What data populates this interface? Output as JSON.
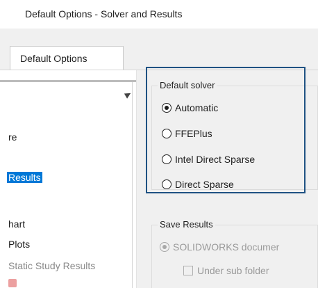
{
  "window": {
    "title": "Default Options - Solver and Results"
  },
  "tabs": [
    {
      "label": "Default Options",
      "active": true
    }
  ],
  "tree": {
    "items": [
      {
        "label": "re",
        "selected": false,
        "dimmed": false
      },
      {
        "label": "Results",
        "selected": true,
        "dimmed": false
      },
      {
        "label": "hart",
        "selected": false,
        "dimmed": false
      },
      {
        "label": "Plots",
        "selected": false,
        "dimmed": false
      },
      {
        "label": "Static Study Results",
        "selected": false,
        "dimmed": true
      }
    ]
  },
  "default_solver": {
    "legend": "Default solver",
    "options": [
      {
        "label": "Automatic",
        "checked": true
      },
      {
        "label": "FFEPlus",
        "checked": false
      },
      {
        "label": "Intel Direct Sparse",
        "checked": false
      },
      {
        "label": "Direct Sparse",
        "checked": false
      }
    ]
  },
  "save_results": {
    "legend": "Save Results",
    "option": {
      "label": "SOLIDWORKS documer",
      "checked": true,
      "enabled": false
    },
    "subfolder": {
      "label": "Under sub folder",
      "checked": false,
      "enabled": false
    }
  },
  "colors": {
    "selection": "#0078d7",
    "highlight_border": "#1f5283",
    "panel_bg": "#f0f0f0"
  }
}
